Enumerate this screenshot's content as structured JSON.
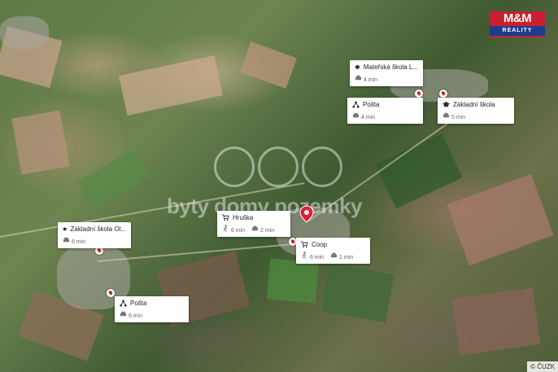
{
  "logo": {
    "main": "M&M",
    "sub": "REALITY"
  },
  "watermark": {
    "text": "byty domy pozemky"
  },
  "copyright": "© ČUZK",
  "colors": {
    "brand_red": "#c8202f",
    "brand_blue": "#1e3c8c",
    "marker": "#e0202e"
  },
  "pois": [
    {
      "title": "Mateřská škola L...",
      "icon": "school-icon",
      "walk": null,
      "car": "4 min"
    },
    {
      "title": "Pošta",
      "icon": "post-office-icon",
      "walk": null,
      "car": "4 min"
    },
    {
      "title": "Základní škola",
      "icon": "school-icon",
      "walk": null,
      "car": "5 min"
    },
    {
      "title": "Hruška",
      "icon": "shop-cart-icon",
      "walk": "6 min",
      "car": "2 min"
    },
    {
      "title": "Coop",
      "icon": "shop-cart-icon",
      "walk": "6 min",
      "car": "1 min"
    },
    {
      "title": "Základní škola Ol...",
      "icon": "school-icon",
      "walk": null,
      "car": "6 min"
    },
    {
      "title": "Pošta",
      "icon": "post-office-icon",
      "walk": null,
      "car": "6 min"
    }
  ]
}
